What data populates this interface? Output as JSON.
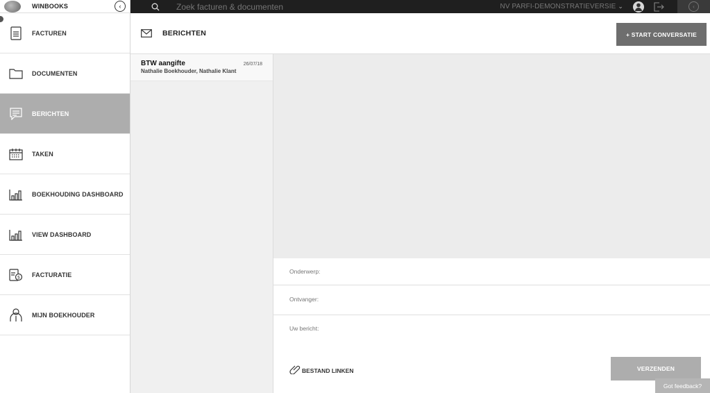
{
  "brand": {
    "name": "WINBOOKS",
    "collapse_icon": "chevron-left-circle-icon"
  },
  "sidebar": {
    "items": [
      {
        "label": "FACTUREN",
        "icon": "invoice-icon",
        "active": false
      },
      {
        "label": "DOCUMENTEN",
        "icon": "folder-icon",
        "active": false
      },
      {
        "label": "BERICHTEN",
        "icon": "message-icon",
        "active": true
      },
      {
        "label": "TAKEN",
        "icon": "calendar-icon",
        "active": false
      },
      {
        "label": "BOEKHOUDING DASHBOARD",
        "icon": "bar-chart-icon",
        "active": false
      },
      {
        "label": "VIEW DASHBOARD",
        "icon": "bar-chart-icon",
        "active": false
      },
      {
        "label": "FACTURATIE",
        "icon": "billing-icon",
        "active": false
      },
      {
        "label": "MIJN BOEKHOUDER",
        "icon": "accountant-icon",
        "active": false
      }
    ]
  },
  "topbar": {
    "search_placeholder": "Zoek facturen & documenten",
    "company": "NV PARFI-DEMONSTRATIEVERSIE",
    "company_chevron": "⌄"
  },
  "header": {
    "title": "BERICHTEN",
    "start_button": "+ START CONVERSATIE"
  },
  "conversations": [
    {
      "subject": "BTW aangifte",
      "date": "26/07/18",
      "participants": "Nathalie Boekhouder, Nathalie Klant"
    }
  ],
  "compose": {
    "subject_placeholder": "Onderwerp:",
    "recipient_placeholder": "Ontvanger:",
    "message_placeholder": "Uw bericht:",
    "link_file_label": "BESTAND LINKEN",
    "send_button": "VERZENDEN"
  },
  "feedback_label": "Got feedback?",
  "colors": {
    "topbar": "#1f1f1f",
    "active_nav": "#adadad",
    "start_button": "#6e6e6e",
    "send_button": "#adadad"
  }
}
